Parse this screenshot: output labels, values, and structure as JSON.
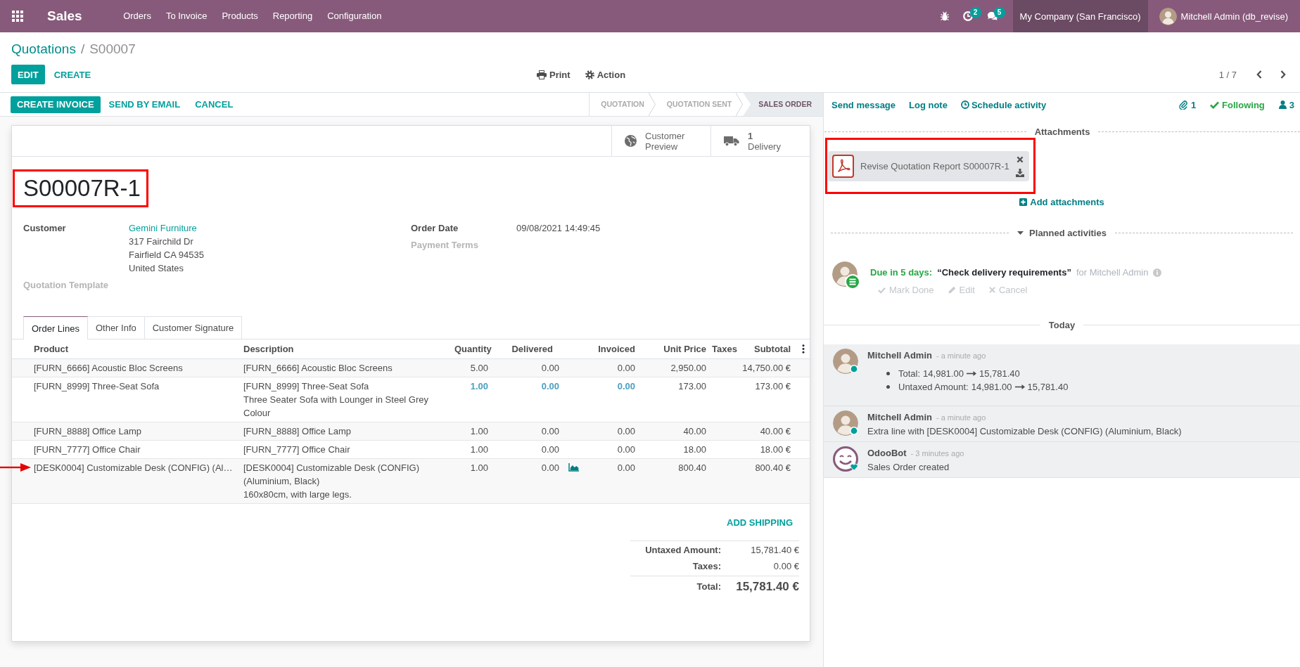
{
  "navbar": {
    "app_name": "Sales",
    "menu": [
      "Orders",
      "To Invoice",
      "Products",
      "Reporting",
      "Configuration"
    ],
    "activity_count": "2",
    "message_count": "5",
    "company": "My Company (San Francisco)",
    "user": "Mitchell Admin (db_revise)"
  },
  "breadcrumb": {
    "items": [
      "Quotations",
      "S00007"
    ],
    "separator": "/"
  },
  "control_panel": {
    "buttons": [
      {
        "label": "EDIT",
        "kind": "primary"
      },
      {
        "label": "CREATE",
        "kind": "link"
      }
    ],
    "actions": [
      {
        "label": "Print",
        "kind": "print"
      },
      {
        "label": "Action",
        "kind": "action"
      }
    ],
    "pager": "1 / 7"
  },
  "statusbar": {
    "buttons": [
      {
        "label": "CREATE INVOICE",
        "kind": "primary"
      },
      {
        "label": "SEND BY EMAIL",
        "kind": "link"
      },
      {
        "label": "CANCEL",
        "kind": "link"
      }
    ],
    "stages": [
      {
        "label": "QUOTATION",
        "selected": false
      },
      {
        "label": "QUOTATION SENT",
        "selected": false
      },
      {
        "label": "SALES ORDER",
        "selected": true
      }
    ]
  },
  "smart_buttons": [
    {
      "kind": "preview",
      "label": "Customer Preview"
    },
    {
      "kind": "delivery",
      "count": "1",
      "label": "Delivery"
    }
  ],
  "title": {
    "text": "S00007R-1",
    "highlighted": true
  },
  "fields": {
    "left": [
      {
        "label": "Customer",
        "kind": "link",
        "value": "Gemini Furniture",
        "address": "317 Fairchild Dr\nFairfield CA 94535\nUnited States"
      },
      {
        "label": "Quotation Template",
        "kind": "empty"
      }
    ],
    "right": [
      {
        "label": "Order Date",
        "kind": "text",
        "value": "09/08/2021 14:49:45"
      },
      {
        "label": "Payment Terms",
        "kind": "empty"
      }
    ]
  },
  "tabs": [
    {
      "label": "Order Lines",
      "selected": true
    },
    {
      "label": "Other Info",
      "selected": false
    },
    {
      "label": "Customer Signature",
      "selected": false
    }
  ],
  "order_lines": {
    "columns": [
      "Product",
      "Description",
      "Quantity",
      "Delivered",
      "Invoiced",
      "Unit Price",
      "Taxes",
      "Subtotal"
    ],
    "rows": [
      {
        "product": "[FURN_6666] Acoustic Bloc Screens",
        "description": "[FURN_6666] Acoustic Bloc Screens",
        "quantity": "5.00",
        "delivered": "0.00",
        "invoiced": "0.00",
        "unit_price": "2,950.00",
        "subtotal": "14,750.00 €",
        "emphasized": false,
        "forecast": false,
        "pointed": false
      },
      {
        "product": "[FURN_8999] Three-Seat Sofa",
        "description": "[FURN_8999] Three-Seat Sofa\nThree Seater Sofa with Lounger in Steel Grey Colour",
        "quantity": "1.00",
        "delivered": "0.00",
        "invoiced": "0.00",
        "unit_price": "173.00",
        "subtotal": "173.00 €",
        "emphasized": true,
        "forecast": false,
        "pointed": false
      },
      {
        "product": "[FURN_8888] Office Lamp",
        "description": "[FURN_8888] Office Lamp",
        "quantity": "1.00",
        "delivered": "0.00",
        "invoiced": "0.00",
        "unit_price": "40.00",
        "subtotal": "40.00 €",
        "emphasized": false,
        "forecast": false,
        "pointed": false
      },
      {
        "product": "[FURN_7777] Office Chair",
        "description": "[FURN_7777] Office Chair",
        "quantity": "1.00",
        "delivered": "0.00",
        "invoiced": "0.00",
        "unit_price": "18.00",
        "subtotal": "18.00 €",
        "emphasized": false,
        "forecast": false,
        "pointed": false
      },
      {
        "product": "[DESK0004] Customizable Desk (CONFIG) (Al…",
        "description": "[DESK0004] Customizable Desk (CONFIG) (Aluminium, Black)\n160x80cm, with large legs.",
        "quantity": "1.00",
        "delivered": "0.00",
        "invoiced": "0.00",
        "unit_price": "800.40",
        "subtotal": "800.40 €",
        "emphasized": false,
        "forecast": true,
        "pointed": true
      }
    ]
  },
  "add_shipping": "ADD SHIPPING",
  "totals": [
    {
      "label": "Untaxed Amount:",
      "value": "15,781.40 €",
      "kind": "subtotal"
    },
    {
      "label": "Taxes:",
      "value": "0.00 €",
      "kind": "subtotal"
    },
    {
      "label": "Total:",
      "value": "15,781.40 €",
      "kind": "total"
    }
  ],
  "chatter": {
    "actions": [
      {
        "label": "Send message",
        "kind": "message"
      },
      {
        "label": "Log note",
        "kind": "note"
      },
      {
        "label": "Schedule activity",
        "kind": "activity"
      }
    ],
    "attachment_count": "1",
    "follow_label": "Following",
    "following": true,
    "follower_count": "3",
    "attachments_title": "Attachments",
    "attachments": [
      {
        "name": "Revise Quotation Report S00007R-1",
        "kind": "pdf",
        "highlighted": true
      }
    ],
    "add_attachments": "Add attachments",
    "activities_title": "Planned activities",
    "activities_expanded": true,
    "activities": [
      {
        "overdue": false,
        "due": "Due in 5 days:",
        "summary": "“Check delivery requirements”",
        "assignee": "for Mitchell Admin",
        "actions": [
          {
            "label": "Mark Done",
            "kind": "done"
          },
          {
            "label": "Edit",
            "kind": "edit"
          },
          {
            "label": "Cancel",
            "kind": "cancel"
          }
        ]
      }
    ],
    "day": "Today",
    "messages": [
      {
        "author": "Mitchell Admin",
        "date": "- a minute ago",
        "kind": "user",
        "tracking": [
          {
            "field": "Total:",
            "old": "14,981.00",
            "new": "15,781.40"
          },
          {
            "field": "Untaxed Amount:",
            "old": "14,981.00",
            "new": "15,781.40"
          }
        ]
      },
      {
        "author": "Mitchell Admin",
        "date": "- a minute ago",
        "kind": "user",
        "body": "Extra line with [DESK0004] Customizable Desk (CONFIG) (Aluminium, Black)"
      },
      {
        "author": "OdooBot",
        "date": "- 3 minutes ago",
        "kind": "bot",
        "body": "Sales Order created"
      }
    ]
  }
}
